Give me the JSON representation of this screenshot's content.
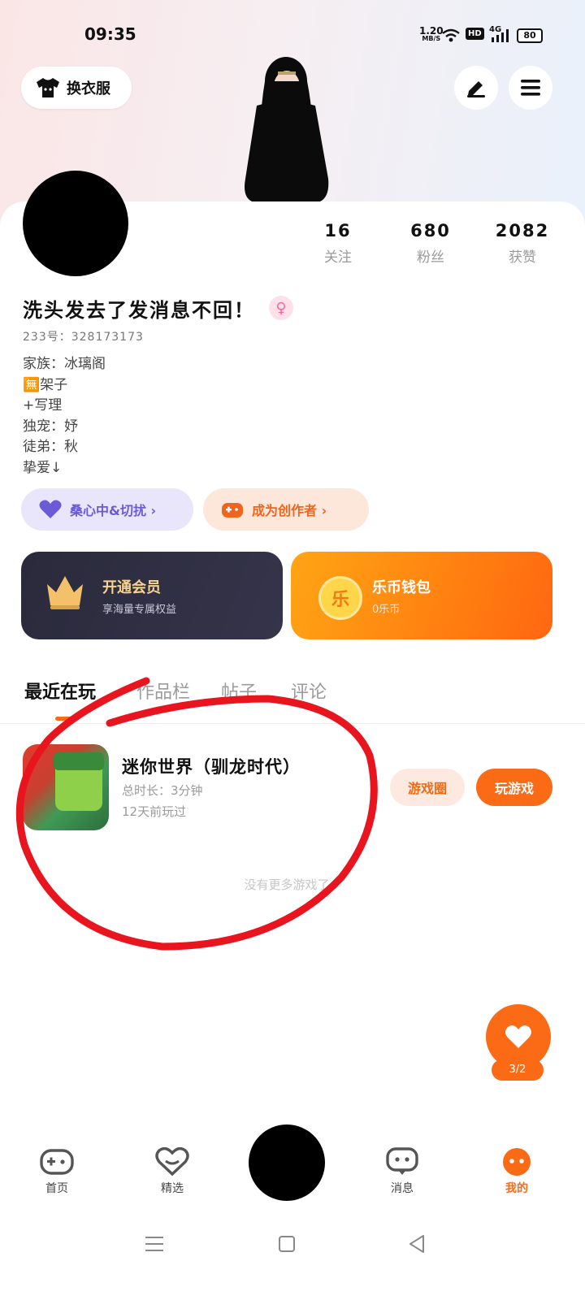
{
  "status_bar": {
    "time": "09:35",
    "net_speed": "1.20",
    "net_unit": "MB/S",
    "hd": "HD",
    "network": "4G",
    "battery": "80"
  },
  "header": {
    "outfit_button": "换衣服"
  },
  "profile": {
    "stats": [
      {
        "value": "16",
        "label": "关注"
      },
      {
        "value": "680",
        "label": "粉丝"
      },
      {
        "value": "2082",
        "label": "获赞"
      }
    ],
    "name": "洗头发去了发消息不回！",
    "gender_symbol": "♀",
    "uid": "233号：328173173",
    "bio": [
      "家族：冰璃阁",
      "🈚架子",
      "+写理",
      "独宠：妤",
      "徒弟：秋",
      "挚爱↓"
    ],
    "tags": [
      {
        "label": "桑心中&切扰 ›"
      },
      {
        "label": "成为创作者 ›"
      }
    ]
  },
  "cards": {
    "vip": {
      "title": "开通会员",
      "subtitle": "享海量专属权益"
    },
    "wallet": {
      "title": "乐币钱包",
      "subtitle": "0乐币",
      "coin_char": "乐"
    }
  },
  "tabs": [
    "最近在玩",
    "作品栏",
    "帖子",
    "评论"
  ],
  "recent_game": {
    "title": "迷你世界（驯龙时代）",
    "duration": "总时长：3分钟",
    "last_played": "12天前玩过",
    "circle_button": "游戏圈",
    "play_button": "玩游戏"
  },
  "empty_text": "没有更多游戏了",
  "floating": {
    "badge": "3/2"
  },
  "bottom_nav": [
    {
      "label": "首页"
    },
    {
      "label": "精选"
    },
    {
      "label": "消息"
    },
    {
      "label": "我的"
    }
  ],
  "colors": {
    "accent": "#fb6a15",
    "vip_card": "#2b2a3d",
    "tag_purple": "#e9e6fb",
    "tag_orange": "#fde6da"
  }
}
